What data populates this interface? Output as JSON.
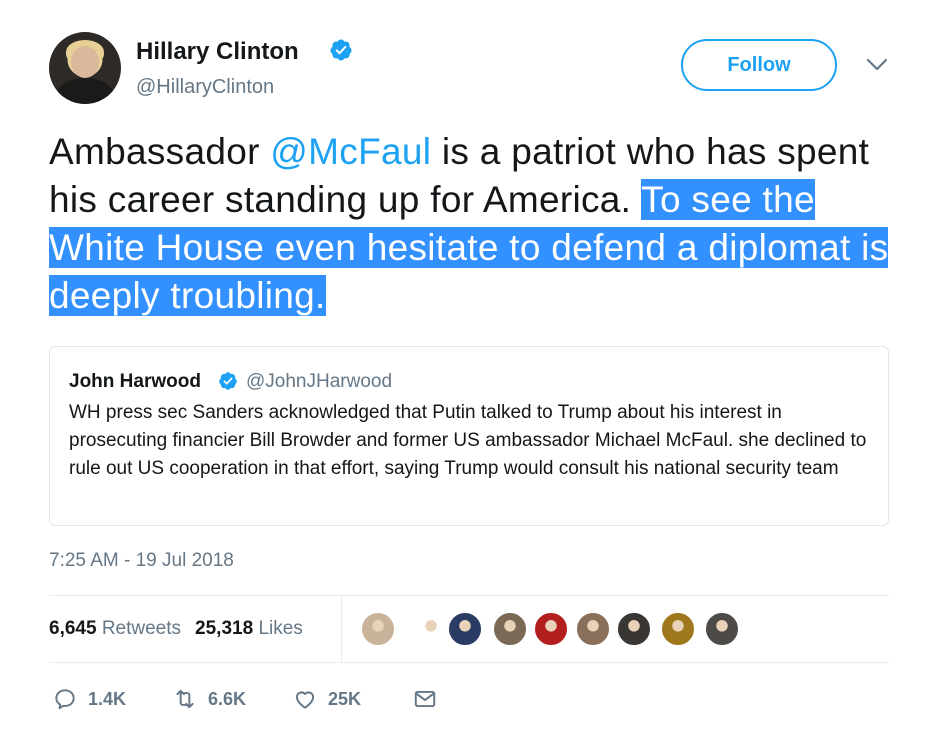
{
  "author": {
    "name": "Hillary Clinton",
    "handle": "@HillaryClinton",
    "follow_label": "Follow"
  },
  "tweet": {
    "text_plain_1": "Ambassador ",
    "mention": "@McFaul",
    "text_plain_2": " is a patriot who has spent his career standing up for America. ",
    "text_selected": "To see the White House even hesitate to defend a diplomat is deeply troubling."
  },
  "quote": {
    "name": "John Harwood",
    "handle": "@JohnJHarwood",
    "text": "WH press sec Sanders acknowledged that Putin talked to Trump about his interest in prosecuting financier Bill Browder and former US ambassador Michael McFaul. she declined to rule out US cooperation in that effort, saying Trump would consult his national security team"
  },
  "timestamp": "7:25 AM - 19 Jul 2018",
  "stats": {
    "retweets_count": "6,645",
    "retweets_label": "Retweets",
    "likes_count": "25,318",
    "likes_label": "Likes"
  },
  "likers": [
    {
      "icon": "liker-avatar-1",
      "color": "#c9b39a"
    },
    {
      "icon": "liker-avatar-2",
      "color": "#ffffff"
    },
    {
      "icon": "liker-avatar-3",
      "color": "#2a3c63"
    },
    {
      "icon": "liker-avatar-4",
      "color": "#7a6a55"
    },
    {
      "icon": "liker-avatar-5",
      "color": "#b31f1f"
    },
    {
      "icon": "liker-avatar-6",
      "color": "#8a6f5a"
    },
    {
      "icon": "liker-avatar-7",
      "color": "#3a3634"
    },
    {
      "icon": "liker-avatar-8",
      "color": "#a0781c"
    },
    {
      "icon": "liker-avatar-9",
      "color": "#4d4a47"
    }
  ],
  "actions": {
    "reply_count": "1.4K",
    "retweet_count": "6.6K",
    "like_count": "25K"
  },
  "colors": {
    "accent": "#1da1f2",
    "selection": "#3390ff",
    "muted": "#657786"
  }
}
